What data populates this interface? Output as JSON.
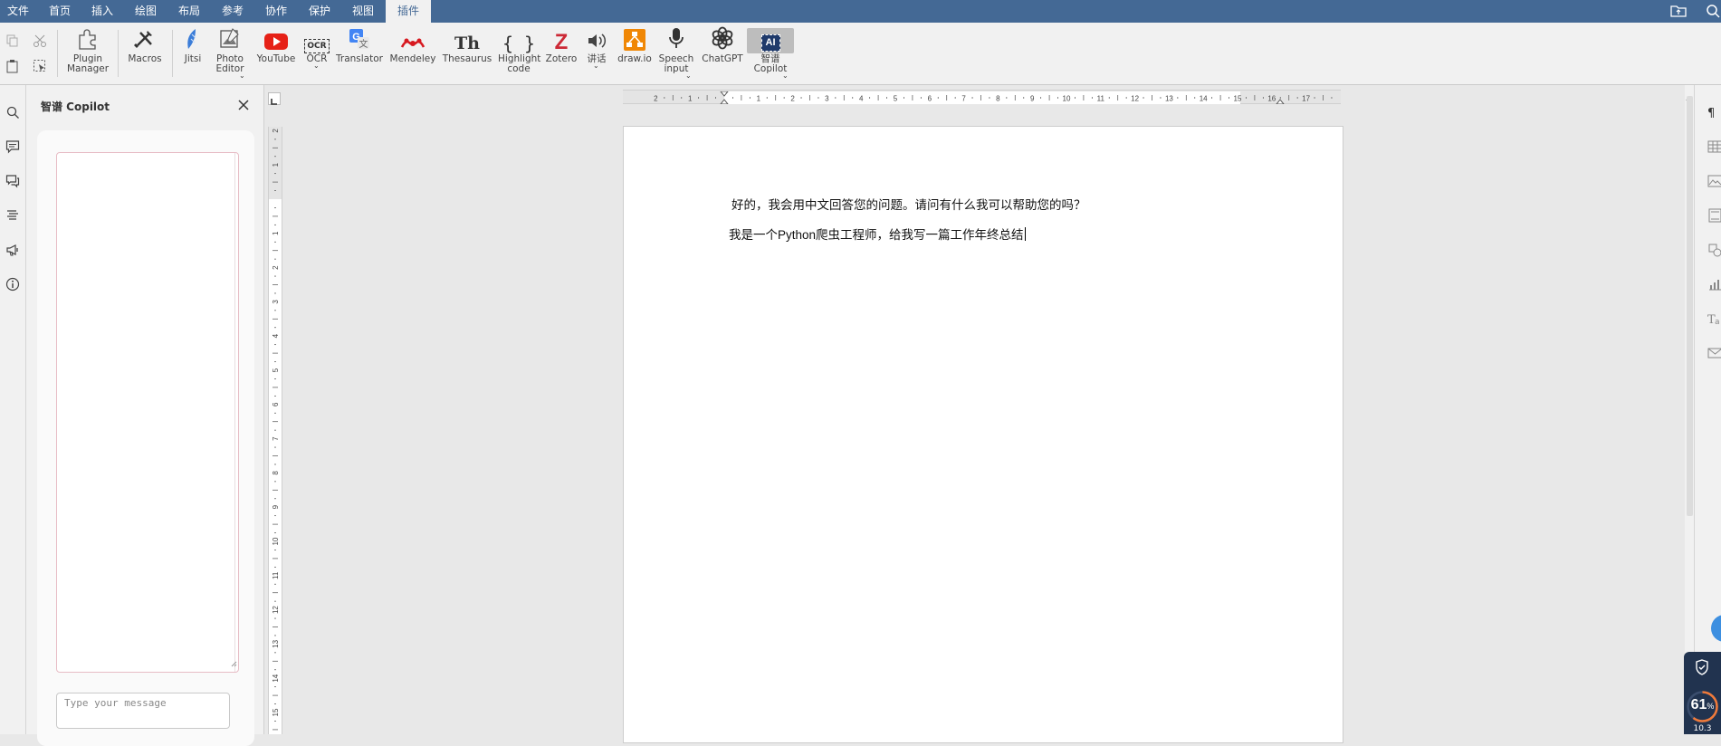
{
  "menubar": {
    "items": [
      "文件",
      "首页",
      "插入",
      "绘图",
      "布局",
      "参考",
      "协作",
      "保护",
      "视图",
      "插件"
    ],
    "active_index": 9
  },
  "toolbar": {
    "buttons": [
      {
        "label": "Plugin\nManager",
        "icon": "plugin-manager-icon"
      },
      {
        "label": "Macros",
        "icon": "macros-icon"
      },
      {
        "label": "Jitsi",
        "icon": "jitsi-icon"
      },
      {
        "label": "Photo\nEditor",
        "icon": "photo-editor-icon",
        "dropdown": true
      },
      {
        "label": "YouTube",
        "icon": "youtube-icon"
      },
      {
        "label": "OCR",
        "icon": "ocr-icon",
        "dropdown": true
      },
      {
        "label": "Translator",
        "icon": "translator-icon"
      },
      {
        "label": "Mendeley",
        "icon": "mendeley-icon"
      },
      {
        "label": "Thesaurus",
        "icon": "thesaurus-icon"
      },
      {
        "label": "Highlight\ncode",
        "icon": "highlight-code-icon"
      },
      {
        "label": "Zotero",
        "icon": "zotero-icon"
      },
      {
        "label": "讲话",
        "icon": "speaker-icon",
        "dropdown": true
      },
      {
        "label": "draw.io",
        "icon": "drawio-icon"
      },
      {
        "label": "Speech\ninput",
        "icon": "microphone-icon",
        "dropdown": true
      },
      {
        "label": "ChatGPT",
        "icon": "chatgpt-icon"
      },
      {
        "label": "智谱\nCopilot",
        "icon": "ai-copilot-icon",
        "dropdown": true,
        "selected": true
      }
    ],
    "glyphs": {
      "thesaurus": "Th",
      "highlight": "{ }",
      "zotero": "Z",
      "ocr": "OCR",
      "ai": "AI"
    }
  },
  "panel": {
    "title": "智谱 Copilot",
    "input_placeholder": "Type your message"
  },
  "rulers": {
    "h_labels": [
      "2",
      "1",
      "1",
      "2",
      "3",
      "4",
      "5",
      "6",
      "7",
      "8",
      "9",
      "10",
      "11",
      "12",
      "13",
      "14",
      "15",
      "16",
      "17"
    ],
    "v_labels": [
      "2",
      "1",
      "1",
      "2",
      "3",
      "4",
      "5",
      "6",
      "7",
      "8",
      "9",
      "10",
      "11",
      "12",
      "13",
      "14",
      "15"
    ]
  },
  "document": {
    "lines": [
      "好的，我会用中文回答您的问题。请问有什么我可以帮助您的吗？",
      "我是一个Python爬虫工程师，给我写一篇工作年终总结"
    ]
  },
  "status_badge": {
    "value": "61",
    "unit": "%",
    "sub": "10.3"
  },
  "colors": {
    "accent": "#446995",
    "youtube": "#e62117",
    "zotero": "#cc2936",
    "mendeley": "#d71920",
    "drawio": "#f08705",
    "translator": "#4285f4",
    "badge": "#21334f"
  }
}
